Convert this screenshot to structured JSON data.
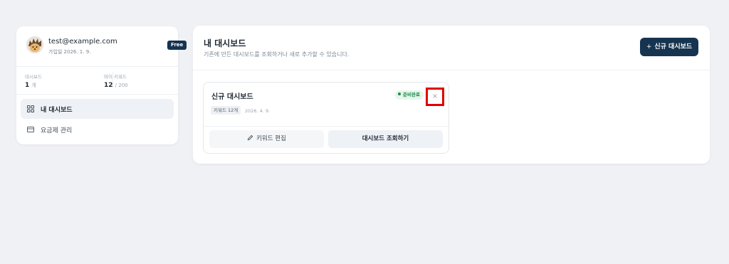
{
  "profile": {
    "email": "test@example.com",
    "joined": "가입일 2026. 1. 9.",
    "plan": "Free"
  },
  "stats": {
    "dashboards": {
      "label": "대시보드",
      "value": "1",
      "unit": "개"
    },
    "keywords": {
      "label": "마이 키워드",
      "value": "12",
      "unit": "/ 200"
    }
  },
  "nav": {
    "items": [
      {
        "label": "내 대시보드",
        "icon": "grid-icon",
        "active": true
      },
      {
        "label": "요금제 관리",
        "icon": "card-icon",
        "active": false
      }
    ]
  },
  "main": {
    "title": "내 대시보드",
    "subtitle": "기존에 만든 대시보드를 조회하거나 새로 추가할 수 있습니다.",
    "new_button": {
      "icon": "+",
      "label": "신규 대시보드"
    }
  },
  "dashboard_card": {
    "title": "신규 대시보드",
    "status": "준비완료",
    "close_symbol": "×",
    "keyword_tag": "키워드 12개",
    "date": "2026. 4. 9.",
    "edit_label": "키워드 편집",
    "view_label": "대시보드 조회하기"
  },
  "colors": {
    "background": "#f0f1f5",
    "brand": "#163450",
    "status_green": "#1c8a4a",
    "highlight_red": "#e10000"
  }
}
